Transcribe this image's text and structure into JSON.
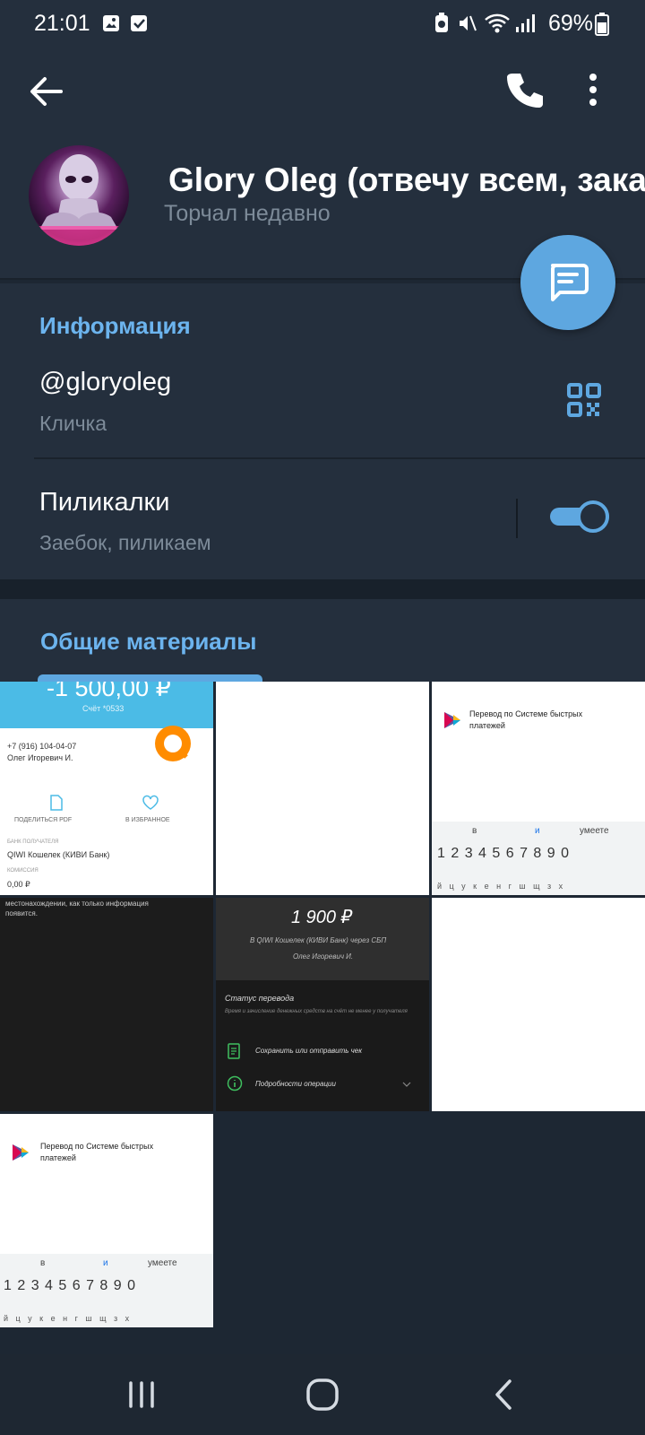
{
  "status_bar": {
    "time": "21:01",
    "battery": "69%"
  },
  "profile": {
    "name": "Glory Oleg (отвечу всем, зака",
    "status": "Торчал недавно"
  },
  "info": {
    "title": "Информация",
    "username": "@gloryoleg",
    "username_label": "Кличка",
    "notifications_title": "Пиликалки",
    "notifications_subtitle": "Заебок, пиликаем",
    "notifications_on": true
  },
  "media": {
    "title": "Общие материалы"
  },
  "thumbs": {
    "qiwi": {
      "amount": "-1 500,00 ₽",
      "account": "Счёт *0533",
      "phone": "+7 (916) 104-04-07",
      "person": "Олег Игоревич И.",
      "share": "ПОДЕЛИТЬСЯ PDF",
      "favorite": "В ИЗБРАННОЕ",
      "bank_label": "БАНК ПОЛУЧАТЕЛЯ",
      "bank": "QIWI Кошелек (КИВИ Банк)",
      "fee_label": "КОМИССИЯ",
      "fee": "0,00 ₽"
    },
    "sbp1": {
      "line1": "Перевод по Системе быстрых",
      "line2": "платежей",
      "suggest1": "в",
      "suggest2": "и",
      "suggest3": "умеете",
      "digits": "1 2 3 4 5 6 7 8 9 0",
      "letters": "й ц у к е н г ш щ з х"
    },
    "dark_text": {
      "line1": "местонахождении, как только информация",
      "line2": "появится."
    },
    "transfer": {
      "amount": "1 900 ₽",
      "line1": "В QIWI Кошелек (КИВИ Банк) через СБП",
      "line2": "Олег Игоревич И.",
      "status_title": "Статус перевода",
      "status_desc": "Время и зачисление денежных средств на счёт не менее у получателя",
      "receipt": "Сохранить или отправить чек",
      "details": "Подробности операции"
    },
    "sbp2": {
      "line1": "Перевод по Системе быстрых",
      "line2": "платежей",
      "suggest1": "в",
      "suggest2": "и",
      "suggest3": "умеете",
      "digits": "1 2 3 4 5 6 7 8 9 0",
      "letters": "й ц у к е н г ш щ з х"
    }
  },
  "icons": [
    "back-arrow-icon",
    "phone-icon",
    "more-vertical-icon",
    "message-icon",
    "qr-code-icon",
    "recents-icon",
    "home-icon",
    "nav-back-icon"
  ],
  "colors": {
    "accent": "#5ea7e0",
    "background": "#1d2733",
    "surface": "#242f3d",
    "secondary_text": "#7d8b99"
  }
}
